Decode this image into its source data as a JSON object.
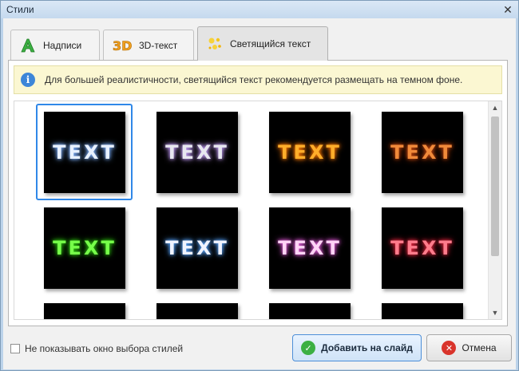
{
  "window": {
    "title": "Стили"
  },
  "tabs": [
    {
      "label": "Надписи"
    },
    {
      "label": "3D-текст"
    },
    {
      "label": "Светящийся текст"
    }
  ],
  "info": {
    "text": "Для большей реалистичности, светящийся текст рекомендуется размещать на темном фоне."
  },
  "styles": [
    {
      "text": "TEXT",
      "color": "#e8f1ff",
      "glow": "#7fb2ff",
      "selected": true
    },
    {
      "text": "TEXT",
      "color": "#e7e7ef",
      "glow": "#c8a0ff",
      "selected": false
    },
    {
      "text": "TEXT",
      "color": "#ffae2a",
      "glow": "#ff7a00",
      "selected": false
    },
    {
      "text": "TEXT",
      "color": "#f18a3a",
      "glow": "#c1440e",
      "selected": false
    },
    {
      "text": "TEXT",
      "color": "#77ff4a",
      "glow": "#2dbf10",
      "selected": false
    },
    {
      "text": "TEXT",
      "color": "#f0f4ff",
      "glow": "#59a6ff",
      "selected": false
    },
    {
      "text": "TEXT",
      "color": "#ffd4f6",
      "glow": "#e05ad8",
      "selected": false
    },
    {
      "text": "TEXT",
      "color": "#ff7c8c",
      "glow": "#e0243d",
      "selected": false
    }
  ],
  "footer": {
    "checkbox_label": "Не показывать окно выбора стилей",
    "add_label": "Добавить на слайд",
    "cancel_label": "Отмена"
  },
  "colors": {
    "accent": "#3088e8",
    "info_bg": "#fbf7d2"
  }
}
